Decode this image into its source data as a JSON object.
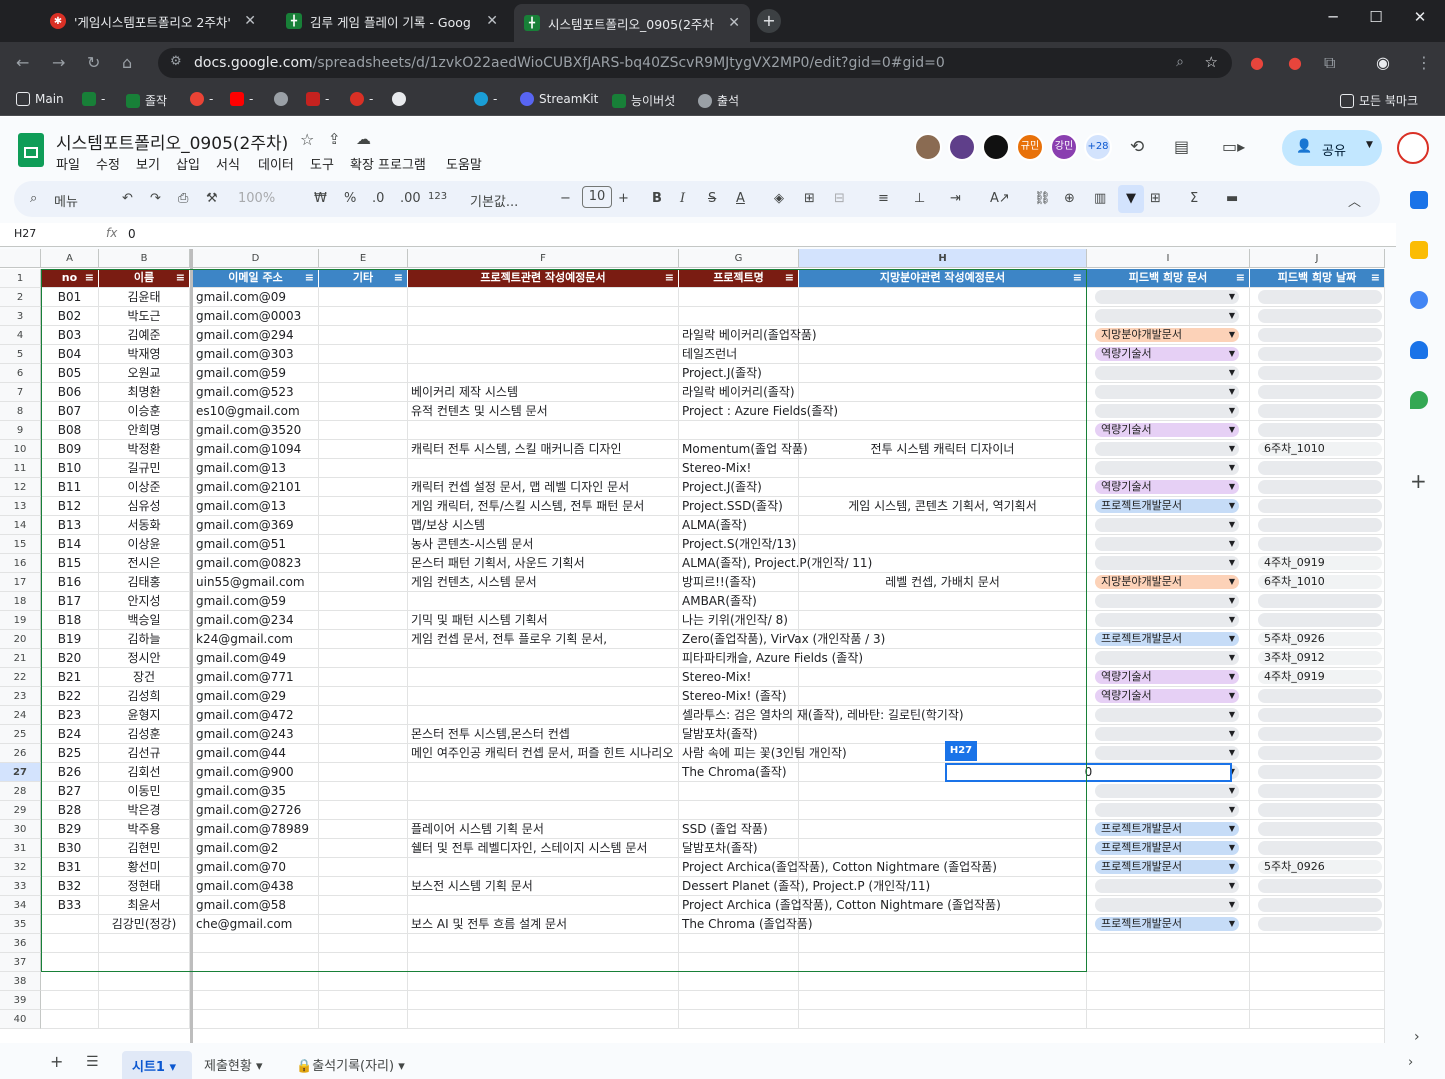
{
  "browser": {
    "tabs": [
      {
        "title": "'게임시스템포트폴리오 2주차'",
        "icon": "red-circle-icon"
      },
      {
        "title": "김루 게임 플레이 기록 - Goog",
        "icon": "sheets-icon"
      },
      {
        "title": "시스템포트폴리오_0905(2주차",
        "icon": "sheets-icon"
      }
    ],
    "url_domain": "docs.google.com",
    "url_path": "/spreadsheets/d/1zvkO22aedWioCUBXfJARS-bq40ZScvR9MJtygVX2MP0/edit?gid=0#gid=0",
    "bookmarks": [
      "Main",
      "졸작",
      "StreamKit",
      "능이버섯",
      "출석"
    ],
    "all_bookmarks": "모든 북마크"
  },
  "doc": {
    "title": "시스템포트폴리오_0905(2주차)",
    "menus": [
      "파일",
      "수정",
      "보기",
      "삽입",
      "서식",
      "데이터",
      "도구",
      "확장 프로그램",
      "도움말"
    ],
    "share_label": "공유",
    "collab_count": "+28",
    "collabs": [
      "규민",
      "강민"
    ]
  },
  "format_bar": {
    "search": "메뉴",
    "zoom": "100%",
    "currency": "₩",
    "percent": "%",
    "dec_dec": ".0",
    "dec_inc": ".00",
    "num": "123",
    "font": "기본값...",
    "font_size": "10"
  },
  "formula_bar": {
    "cell_ref": "H27",
    "fx": "fx",
    "value": "0"
  },
  "columns": [
    "A",
    "B",
    "D",
    "E",
    "F",
    "G",
    "H",
    "I",
    "J"
  ],
  "headers": [
    "no",
    "이름",
    "이메일 주소",
    "기타",
    "프로젝트관련 작성예정문서",
    "프로젝트명",
    "지망분야관련 작성예정문서",
    "피드백 희망 문서",
    "피드백 희망 날짜"
  ],
  "row_numbers": [
    "1",
    "2",
    "3",
    "4",
    "5",
    "6",
    "7",
    "8",
    "9",
    "10",
    "11",
    "12",
    "13",
    "14",
    "15",
    "16",
    "17",
    "18",
    "19",
    "20",
    "21",
    "22",
    "23",
    "24",
    "25",
    "26",
    "27",
    "28",
    "29",
    "30",
    "31",
    "32",
    "33",
    "34",
    "35",
    "36",
    "37",
    "38",
    "39",
    "40"
  ],
  "rows": [
    {
      "no": "B01",
      "name": "김윤태",
      "email": "09@gmail.com",
      "etc": "",
      "proj_doc": "",
      "proj": "",
      "field_doc": "",
      "fb": "",
      "date": ""
    },
    {
      "no": "B02",
      "name": "박도근",
      "email": "0003@gmail.com",
      "etc": "",
      "proj_doc": "",
      "proj": "",
      "field_doc": "",
      "fb": "",
      "date": ""
    },
    {
      "no": "B03",
      "name": "김예준",
      "email": "294@gmail.com",
      "etc": "",
      "proj_doc": "",
      "proj": "라일락 베이커리(졸업작품)",
      "field_doc": "",
      "fb": "지망분야개발문서",
      "date": ""
    },
    {
      "no": "B04",
      "name": "박재영",
      "email": "303@gmail.com",
      "etc": "",
      "proj_doc": "",
      "proj": "테일즈런너",
      "field_doc": "",
      "fb": "역량기술서",
      "date": ""
    },
    {
      "no": "B05",
      "name": "오원교",
      "email": "59@gmail.com",
      "etc": "",
      "proj_doc": "",
      "proj": "Project.J(졸작)",
      "field_doc": "",
      "fb": "",
      "date": ""
    },
    {
      "no": "B06",
      "name": "최명환",
      "email": "523@gmail.com",
      "etc": "",
      "proj_doc": "베이커리 제작 시스템",
      "proj": "라일락 베이커리(졸작)",
      "field_doc": "",
      "fb": "",
      "date": ""
    },
    {
      "no": "B07",
      "name": "이승훈",
      "email": "es10@gmail.com",
      "etc": "",
      "proj_doc": "유적 컨텐츠 및 시스템 문서",
      "proj": "Project : Azure Fields(졸작)",
      "field_doc": "",
      "fb": "",
      "date": ""
    },
    {
      "no": "B08",
      "name": "안희명",
      "email": "3520@gmail.com",
      "etc": "",
      "proj_doc": "",
      "proj": "",
      "field_doc": "",
      "fb": "역량기술서",
      "date": ""
    },
    {
      "no": "B09",
      "name": "박정환",
      "email": "1094@gmail.com",
      "etc": "",
      "proj_doc": "캐릭터 전투 시스템, 스킬 매커니즘 디자인",
      "proj": "Momentum(졸업 작품)",
      "field_doc": "전투 시스템 캐릭터 디자이너",
      "fb": "",
      "date": "6주차_1010"
    },
    {
      "no": "B10",
      "name": "길규민",
      "email": "13@gmail.com",
      "etc": "",
      "proj_doc": "",
      "proj": "Stereo-Mix!",
      "field_doc": "",
      "fb": "",
      "date": ""
    },
    {
      "no": "B11",
      "name": "이상준",
      "email": "2101@gmail.com",
      "etc": "",
      "proj_doc": "캐릭터 컨셉 설정 문서, 맵 레벨 디자인 문서",
      "proj": "Project.J(졸작)",
      "field_doc": "",
      "fb": "역량기술서",
      "date": ""
    },
    {
      "no": "B12",
      "name": "심유성",
      "email": "13@gmail.com",
      "etc": "",
      "proj_doc": "게임 캐릭터, 전투/스킬 시스템, 전투 패턴 문서",
      "proj": "Project.SSD(졸작)",
      "field_doc": "게임 시스템, 콘텐츠 기획서, 역기획서",
      "fb": "프로젝트개발문서",
      "date": ""
    },
    {
      "no": "B13",
      "name": "서동화",
      "email": "369@gmail.com",
      "etc": "",
      "proj_doc": "맵/보상 시스템",
      "proj": "ALMA(졸작)",
      "field_doc": "",
      "fb": "",
      "date": ""
    },
    {
      "no": "B14",
      "name": "이상윤",
      "email": "51@gmail.com",
      "etc": "",
      "proj_doc": "농사 콘텐츠-시스템 문서",
      "proj": "Project.S(개인작/13)",
      "field_doc": "",
      "fb": "",
      "date": ""
    },
    {
      "no": "B15",
      "name": "전시은",
      "email": "0823@gmail.com",
      "etc": "",
      "proj_doc": "몬스터 패턴 기획서, 사운드 기획서",
      "proj": "ALMA(졸작), Project.P(개인작/ 11)",
      "field_doc": "",
      "fb": "",
      "date": "4주차_0919"
    },
    {
      "no": "B16",
      "name": "김태홍",
      "email": "uin55@gmail.com",
      "etc": "",
      "proj_doc": "게임 컨텐츠, 시스템 문서",
      "proj": "방피르!!(졸작)",
      "field_doc": "레벨 컨셉, 가배치 문서",
      "fb": "지망분야개발문서",
      "date": "6주차_1010"
    },
    {
      "no": "B17",
      "name": "안지성",
      "email": "59@gmail.com",
      "etc": "",
      "proj_doc": "",
      "proj": "AMBAR(졸작)",
      "field_doc": "",
      "fb": "",
      "date": ""
    },
    {
      "no": "B18",
      "name": "백승일",
      "email": "234@gmail.com",
      "etc": "",
      "proj_doc": "기믹 및 패턴 시스템 기획서",
      "proj": "나는 키위(개인작/ 8)",
      "field_doc": "",
      "fb": "",
      "date": ""
    },
    {
      "no": "B19",
      "name": "김하늘",
      "email": "k24@gmail.com",
      "etc": "",
      "proj_doc": "게임 컨셉 문서, 전투 플로우 기획 문서,",
      "proj": "Zero(졸업작품), VirVax (개인작품 / 3)",
      "field_doc": "",
      "fb": "프로젝트개발문서",
      "date": "5주차_0926"
    },
    {
      "no": "B20",
      "name": "정시안",
      "email": "49@gmail.com",
      "etc": "",
      "proj_doc": "",
      "proj": "피타파티캐슬, Azure Fields (졸작)",
      "field_doc": "",
      "fb": "",
      "date": "3주차_0912"
    },
    {
      "no": "B21",
      "name": "장건",
      "email": "771@gmail.com",
      "etc": "",
      "proj_doc": "",
      "proj": "Stereo-Mix!",
      "field_doc": "",
      "fb": "역량기술서",
      "date": "4주차_0919"
    },
    {
      "no": "B22",
      "name": "김성희",
      "email": "29@gmail.com",
      "etc": "",
      "proj_doc": "",
      "proj": "Stereo-Mix! (졸작)",
      "field_doc": "",
      "fb": "역량기술서",
      "date": ""
    },
    {
      "no": "B23",
      "name": "윤형지",
      "email": "472@gmail.com",
      "etc": "",
      "proj_doc": "",
      "proj": "셀라투스: 검은 열차의 재(졸작), 레바탄: 길로틴(학기작)",
      "field_doc": "",
      "fb": "",
      "date": ""
    },
    {
      "no": "B24",
      "name": "김성훈",
      "email": "243@gmail.com",
      "etc": "",
      "proj_doc": "몬스터 전투 시스템,몬스터 컨셉",
      "proj": "달밤포차(졸작)",
      "field_doc": "",
      "fb": "",
      "date": ""
    },
    {
      "no": "B25",
      "name": "김선규",
      "email": "44@gmail.com",
      "etc": "",
      "proj_doc": "메인 여주인공 캐릭터 컨셉 문서, 퍼즐 힌트 시나리오",
      "proj": "사람 속에 피는 꽃(3인팀 개인작)",
      "field_doc": "",
      "fb": "",
      "date": ""
    },
    {
      "no": "B26",
      "name": "김회선",
      "email": "900@gmail.com",
      "etc": "",
      "proj_doc": "",
      "proj": "The Chroma(졸작)",
      "field_doc": "",
      "fb": "",
      "date": ""
    },
    {
      "no": "B27",
      "name": "이동민",
      "email": "35@gmail.com",
      "etc": "",
      "proj_doc": "",
      "proj": "",
      "field_doc": "",
      "fb": "",
      "date": ""
    },
    {
      "no": "B28",
      "name": "박은경",
      "email": "2726@gmail.com",
      "etc": "",
      "proj_doc": "",
      "proj": "",
      "field_doc": "",
      "fb": "",
      "date": ""
    },
    {
      "no": "B29",
      "name": "박주용",
      "email": "78989@gmail.com",
      "etc": "",
      "proj_doc": "플레이어 시스템 기획 문서",
      "proj": "SSD (졸업 작품)",
      "field_doc": "",
      "fb": "프로젝트개발문서",
      "date": ""
    },
    {
      "no": "B30",
      "name": "김현민",
      "email": "2@gmail.com",
      "etc": "",
      "proj_doc": "쉘터 및 전투 레벨디자인, 스테이지 시스템 문서",
      "proj": "달밤포차(졸작)",
      "field_doc": "",
      "fb": "프로젝트개발문서",
      "date": ""
    },
    {
      "no": "B31",
      "name": "황선미",
      "email": "70@gmail.com",
      "etc": "",
      "proj_doc": "",
      "proj": "Project Archica(졸업작품), Cotton Nightmare (졸업작품)",
      "field_doc": "",
      "fb": "프로젝트개발문서",
      "date": "5주차_0926"
    },
    {
      "no": "B32",
      "name": "정현태",
      "email": "438@gmail.com",
      "etc": "",
      "proj_doc": "보스전 시스템 기획 문서",
      "proj": "Dessert Planet (졸작), Project.P (개인작/11)",
      "field_doc": "",
      "fb": "",
      "date": ""
    },
    {
      "no": "B33",
      "name": "최윤서",
      "email": "58@gmail.com",
      "etc": "",
      "proj_doc": "",
      "proj": "Project Archica (졸업작품), Cotton Nightmare (졸업작품)",
      "field_doc": "",
      "fb": "",
      "date": ""
    },
    {
      "no": "",
      "name": "김강민(정강)",
      "email": "che@gmail.com",
      "etc": "",
      "proj_doc": "보스 AI 및 전투 흐름 설계 문서",
      "proj": "The Chroma (졸업작품)",
      "field_doc": "",
      "fb": "프로젝트개발문서",
      "date": ""
    }
  ],
  "cell_tooltip": "H27",
  "active_cell_value": "0",
  "sheets": [
    "시트1",
    "제출현황",
    "출석기록(자리)"
  ],
  "colors": {
    "header_dark": "#7a1c12",
    "header_blue": "#3d85c6",
    "chip_purple": "#e6d0f5",
    "chip_orange": "#fcd2b8",
    "chip_blue": "#c6dcf7",
    "accent": "#0b57d0"
  }
}
